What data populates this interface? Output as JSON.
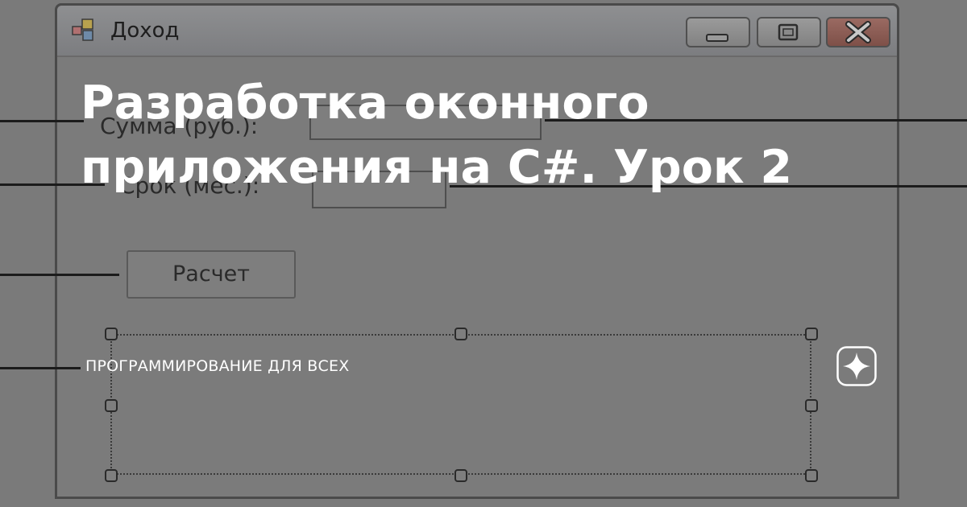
{
  "window": {
    "title": "Доход",
    "icon": "winforms-app-icon",
    "controls": {
      "minimize_icon": "minimize-icon",
      "maximize_icon": "maximize-icon",
      "close_icon": "close-icon"
    }
  },
  "form": {
    "sum_label": "Сумма (руб.):",
    "sum_value": "",
    "term_label": "Срок (мес.):",
    "term_value": "",
    "calculate_button": "Расчет",
    "result_label": ""
  },
  "article": {
    "title": "Разработка оконного приложения на C#. Урок 2",
    "channel": "ПРОГРАММИРОВАНИЕ ДЛЯ ВСЕХ",
    "channel_icon": "dzen-sparkle-icon"
  },
  "colors": {
    "overlay_text": "#ffffff",
    "background": "#7a7a7a"
  }
}
